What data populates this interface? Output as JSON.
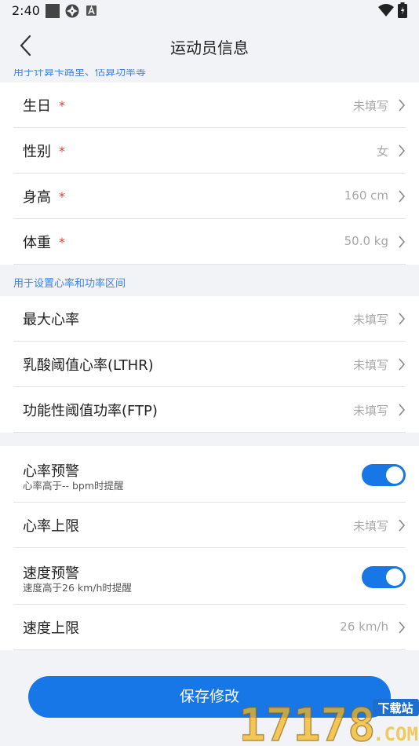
{
  "status_bar": {
    "time": "2:40"
  },
  "header": {
    "title": "运动员信息"
  },
  "section1": {
    "hint": "用于计算卡路里、估算功率等",
    "rows": [
      {
        "label": "生日",
        "value": "未填写"
      },
      {
        "label": "性别",
        "value": "女"
      },
      {
        "label": "身高",
        "value": "160 cm"
      },
      {
        "label": "体重",
        "value": "50.0 kg"
      }
    ]
  },
  "section2": {
    "hint": "用于设置心率和功率区间",
    "rows": [
      {
        "label": "最大心率",
        "value": "未填写"
      },
      {
        "label": "乳酸阈值心率(LTHR)",
        "value": "未填写"
      },
      {
        "label": "功能性阈值功率(FTP)",
        "value": "未填写"
      }
    ]
  },
  "section3": {
    "hr_alert": {
      "label": "心率预警",
      "sub": "心率高于-- bpm时提醒",
      "on": true
    },
    "hr_limit": {
      "label": "心率上限",
      "value": "未填写"
    },
    "speed_alert": {
      "label": "速度预警",
      "sub": "速度高于26 km/h时提醒",
      "on": true
    },
    "speed_limit": {
      "label": "速度上限",
      "value": "26 km/h"
    }
  },
  "required_mark": "*",
  "save_button": "保存修改",
  "watermark": {
    "text": "17178",
    "badge": "下载站",
    "domain": ".COM"
  },
  "colors": {
    "accent": "#1877e6",
    "hint": "#3d84e6",
    "required": "#e33b3b",
    "background": "#f1f3f6"
  }
}
